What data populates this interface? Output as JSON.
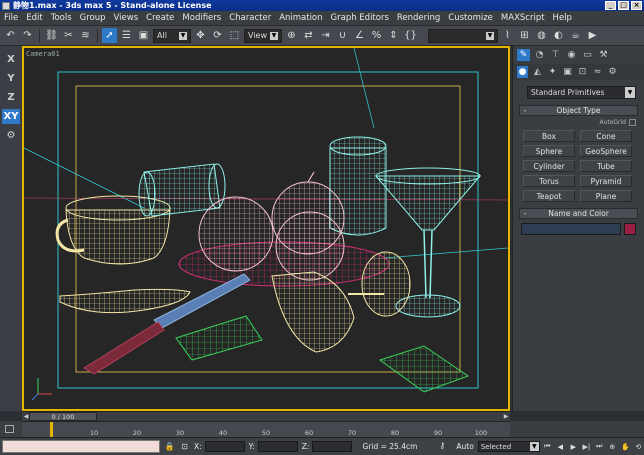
{
  "window": {
    "title": "静物1.max - 3ds max 5 - Stand-alone License"
  },
  "menu": [
    "File",
    "Edit",
    "Tools",
    "Group",
    "Views",
    "Create",
    "Modifiers",
    "Character",
    "Animation",
    "Graph Editors",
    "Rendering",
    "Customize",
    "MAXScript",
    "Help"
  ],
  "toolbar": {
    "selection_filter": "All",
    "ref_coord": "View"
  },
  "axes": [
    "X",
    "Y",
    "Z",
    "XY"
  ],
  "viewport": {
    "label": "Camera01",
    "accent": "#e3b500"
  },
  "command_panel": {
    "category": "Standard Primitives",
    "object_type_title": "Object Type",
    "autogrid_label": "AutoGrid",
    "primitives": [
      "Box",
      "Cone",
      "Sphere",
      "GeoSphere",
      "Cylinder",
      "Tube",
      "Torus",
      "Pyramid",
      "Teapot",
      "Plane"
    ],
    "name_color_title": "Name and Color",
    "object_color": "#9b1e45"
  },
  "timeline": {
    "frame_display": "0 / 100",
    "ticks": [
      "10",
      "20",
      "30",
      "40",
      "50",
      "60",
      "70",
      "80",
      "90",
      "100"
    ]
  },
  "status": {
    "x_label": "X:",
    "y_label": "Y:",
    "z_label": "Z:",
    "grid": "Grid = 25.4cm",
    "auto_label": "Auto",
    "key_filter": "Selected"
  }
}
